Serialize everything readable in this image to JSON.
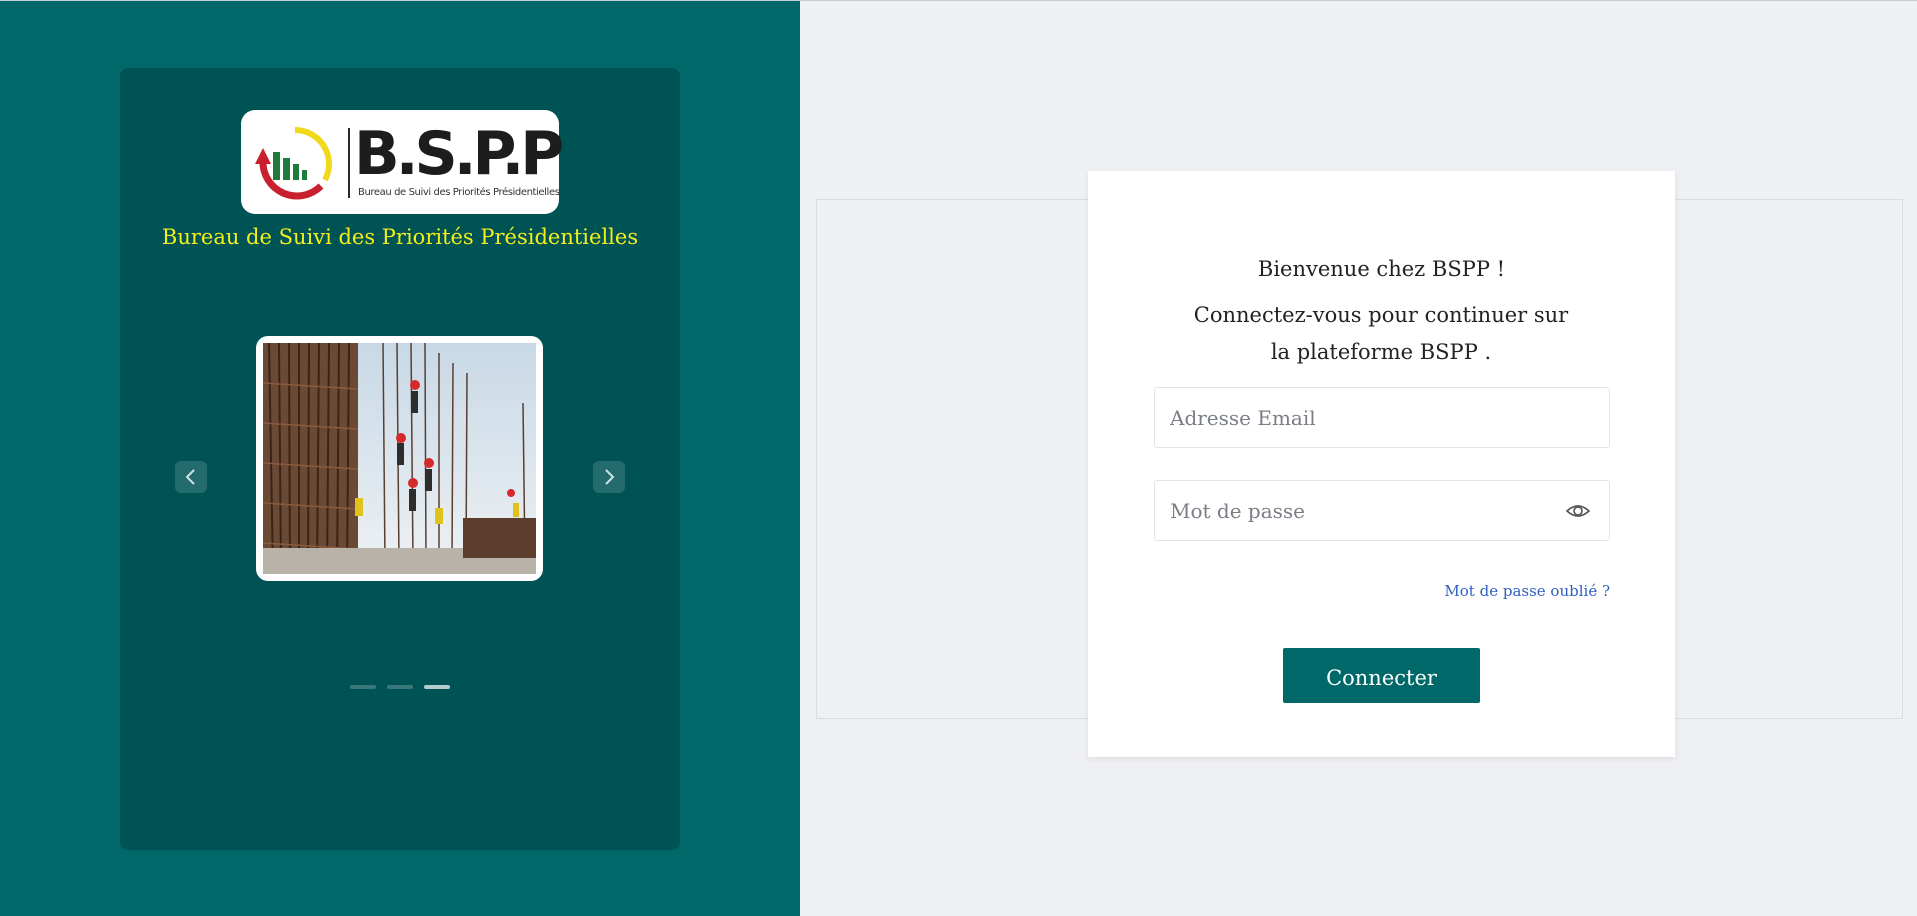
{
  "brand": {
    "logo_text": "B.S.P.P",
    "logo_subtitle": "Bureau de Suivi des Priorités Présidentielles",
    "org_title": "Bureau de Suivi des Priorités Présidentielles",
    "panel_color": "#006868",
    "title_color": "#f3ee1c"
  },
  "carousel": {
    "prev_icon": "chevron-left-icon",
    "next_icon": "chevron-right-icon",
    "slide_count": 3,
    "active_index": 2
  },
  "login": {
    "welcome": "Bienvenue chez BSPP !",
    "subtitle": "Connectez-vous pour continuer sur la plateforme BSPP .",
    "email_placeholder": "Adresse Email",
    "password_placeholder": "Mot de passe",
    "password_toggle_icon": "eye-icon",
    "forgot_password": "Mot de passe oublié ?",
    "submit_label": "Connecter",
    "accent_color": "#006868",
    "link_color": "#2f5fc4"
  }
}
